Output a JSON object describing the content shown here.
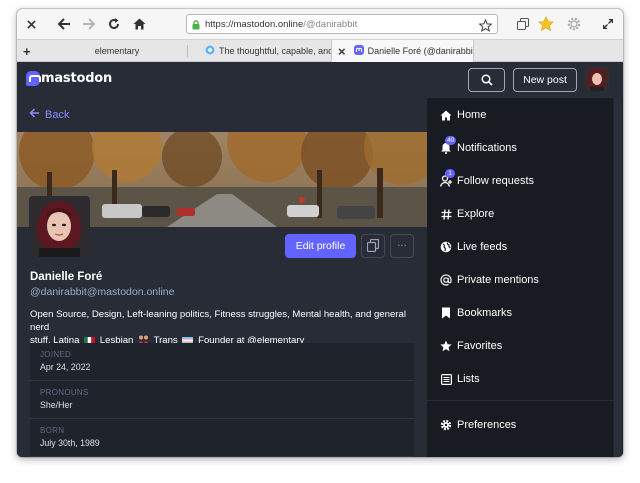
{
  "browser": {
    "url_host": "https://mastodon.online",
    "url_path": "/@danirabbit",
    "tabs": [
      {
        "label": "elementary"
      },
      {
        "label": "The thoughtful, capable, and"
      },
      {
        "label": "Danielle Foré (@danirabbit"
      }
    ],
    "new_tab_symbol": "+",
    "close_symbol": "×"
  },
  "header": {
    "logo_text": "mastodon",
    "new_post_label": "New post"
  },
  "profile": {
    "back_label": "Back",
    "edit_profile_label": "Edit profile",
    "display_name": "Danielle Foré",
    "handle": "@danirabbit@mastodon.online",
    "bio_line1": "Open Source, Design, Left-leaning politics, Fitness struggles, Mental health, and general nerd",
    "bio_stuff": "stuff. Latina",
    "bio_lesbian": "Lesbian",
    "bio_trans": "Trans",
    "bio_founder": "Founder at @elementary",
    "more_symbol": "···",
    "fields": [
      {
        "label": "JOINED",
        "value": "Apr 24, 2022"
      },
      {
        "label": "PRONOUNS",
        "value": "She/Her"
      },
      {
        "label": "BORN",
        "value": "July 30th, 1989"
      }
    ]
  },
  "nav": {
    "items": [
      {
        "label": "Home",
        "icon": "home-icon"
      },
      {
        "label": "Notifications",
        "icon": "bell-icon",
        "badge": "40"
      },
      {
        "label": "Follow requests",
        "icon": "user-add-icon",
        "badge": "1"
      },
      {
        "label": "Explore",
        "icon": "hashtag-icon"
      },
      {
        "label": "Live feeds",
        "icon": "globe-icon"
      },
      {
        "label": "Private mentions",
        "icon": "at-icon"
      },
      {
        "label": "Bookmarks",
        "icon": "bookmark-icon"
      },
      {
        "label": "Favorites",
        "icon": "star-icon"
      },
      {
        "label": "Lists",
        "icon": "list-icon"
      },
      {
        "label": "Preferences",
        "icon": "cog-icon"
      }
    ]
  },
  "colors": {
    "accent": "#6364ff",
    "link": "#8c8dff",
    "panel": "#282c37",
    "background": "#191b22"
  }
}
